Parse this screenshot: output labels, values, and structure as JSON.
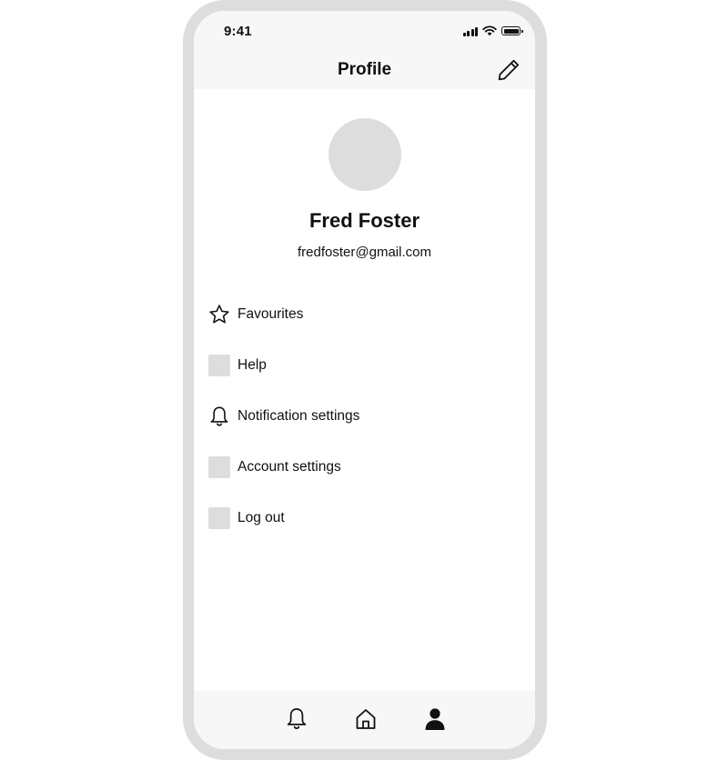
{
  "status_bar": {
    "time": "9:41",
    "icons": [
      "signal-icon",
      "wifi-icon",
      "battery-icon"
    ]
  },
  "header": {
    "title": "Profile",
    "edit_icon": "pencil-icon"
  },
  "profile": {
    "name": "Fred Foster",
    "email": "fredfoster@gmail.com"
  },
  "menu": {
    "items": [
      {
        "label": "Favourites",
        "icon": "star-icon"
      },
      {
        "label": "Help",
        "icon": "placeholder-icon"
      },
      {
        "label": "Notification settings",
        "icon": "bell-icon"
      },
      {
        "label": "Account settings",
        "icon": "placeholder-icon"
      },
      {
        "label": "Log out",
        "icon": "placeholder-icon"
      }
    ]
  },
  "tab_bar": {
    "tabs": [
      {
        "icon": "bell-icon",
        "active": false
      },
      {
        "icon": "home-icon",
        "active": false
      },
      {
        "icon": "person-icon",
        "active": true
      }
    ]
  },
  "colors": {
    "frame": "#dddddd",
    "bar_background": "#f7f7f7",
    "placeholder": "#dddddd",
    "text": "#111111"
  }
}
